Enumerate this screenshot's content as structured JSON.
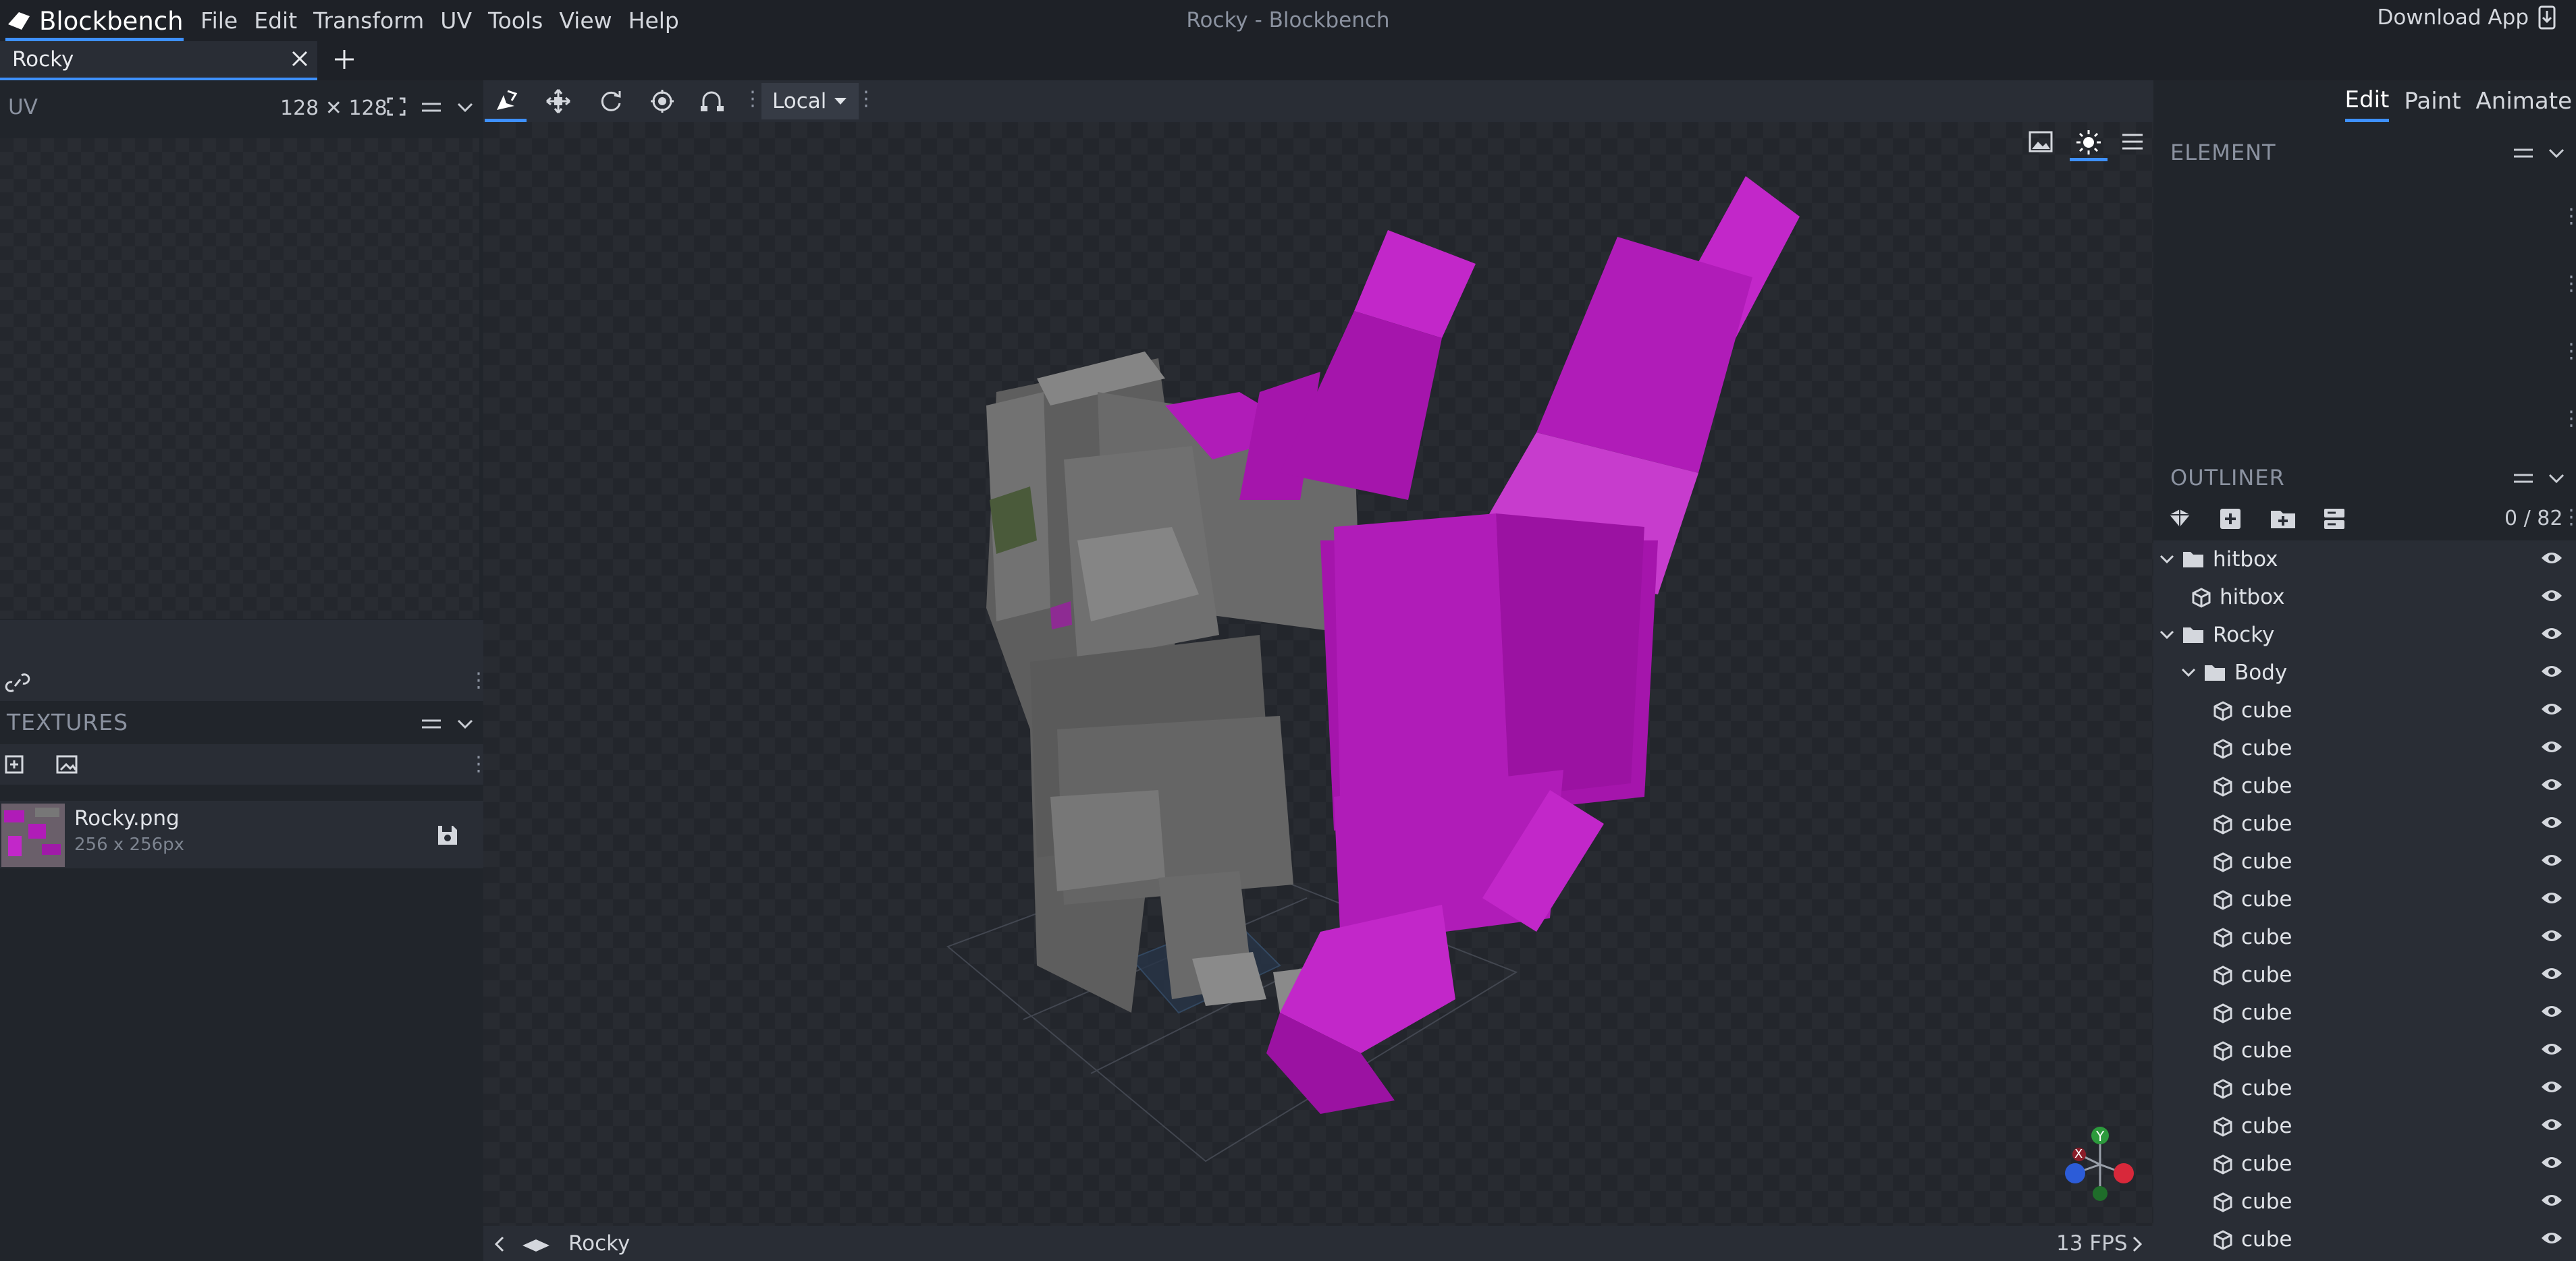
{
  "app": {
    "logo": "Blockbench",
    "window_title": "Rocky - Blockbench",
    "download_label": "Download App"
  },
  "menu": [
    "File",
    "Edit",
    "Transform",
    "UV",
    "Tools",
    "View",
    "Help"
  ],
  "tab": {
    "label": "Rocky"
  },
  "uv_panel": {
    "title": "UV",
    "size": "128 ✕ 128"
  },
  "textures": {
    "title": "TEXTURES",
    "items": [
      {
        "name": "Rocky.png",
        "size": "256 x 256px"
      }
    ]
  },
  "toolbar": {
    "space_select": "Local"
  },
  "modes": [
    {
      "label": "Edit",
      "active": true
    },
    {
      "label": "Paint",
      "active": false
    },
    {
      "label": "Animate",
      "active": false
    }
  ],
  "element_panel": {
    "title": "ELEMENT"
  },
  "outliner": {
    "title": "OUTLINER",
    "count": "0 / 82",
    "rows": [
      {
        "label": "hitbox",
        "type": "group",
        "depth": 0
      },
      {
        "label": "hitbox",
        "type": "cube",
        "depth": 1
      },
      {
        "label": "Rocky",
        "type": "group",
        "depth": 0
      },
      {
        "label": "Body",
        "type": "group",
        "depth": 1
      },
      {
        "label": "cube",
        "type": "cube",
        "depth": 2
      },
      {
        "label": "cube",
        "type": "cube",
        "depth": 2
      },
      {
        "label": "cube",
        "type": "cube",
        "depth": 2
      },
      {
        "label": "cube",
        "type": "cube",
        "depth": 2
      },
      {
        "label": "cube",
        "type": "cube",
        "depth": 2
      },
      {
        "label": "cube",
        "type": "cube",
        "depth": 2
      },
      {
        "label": "cube",
        "type": "cube",
        "depth": 2
      },
      {
        "label": "cube",
        "type": "cube",
        "depth": 2
      },
      {
        "label": "cube",
        "type": "cube",
        "depth": 2
      },
      {
        "label": "cube",
        "type": "cube",
        "depth": 2
      },
      {
        "label": "cube",
        "type": "cube",
        "depth": 2
      },
      {
        "label": "cube",
        "type": "cube",
        "depth": 2
      },
      {
        "label": "cube",
        "type": "cube",
        "depth": 2
      },
      {
        "label": "cube",
        "type": "cube",
        "depth": 2
      },
      {
        "label": "cube",
        "type": "cube",
        "depth": 2
      }
    ]
  },
  "statusbar": {
    "model": "Rocky",
    "fps": "13 FPS"
  },
  "gizmo": {
    "x": "X",
    "y": "Y"
  },
  "colors": {
    "accent": "#3e90ff",
    "magenta": "#b01cb8",
    "stone": "#6e6e6e"
  }
}
